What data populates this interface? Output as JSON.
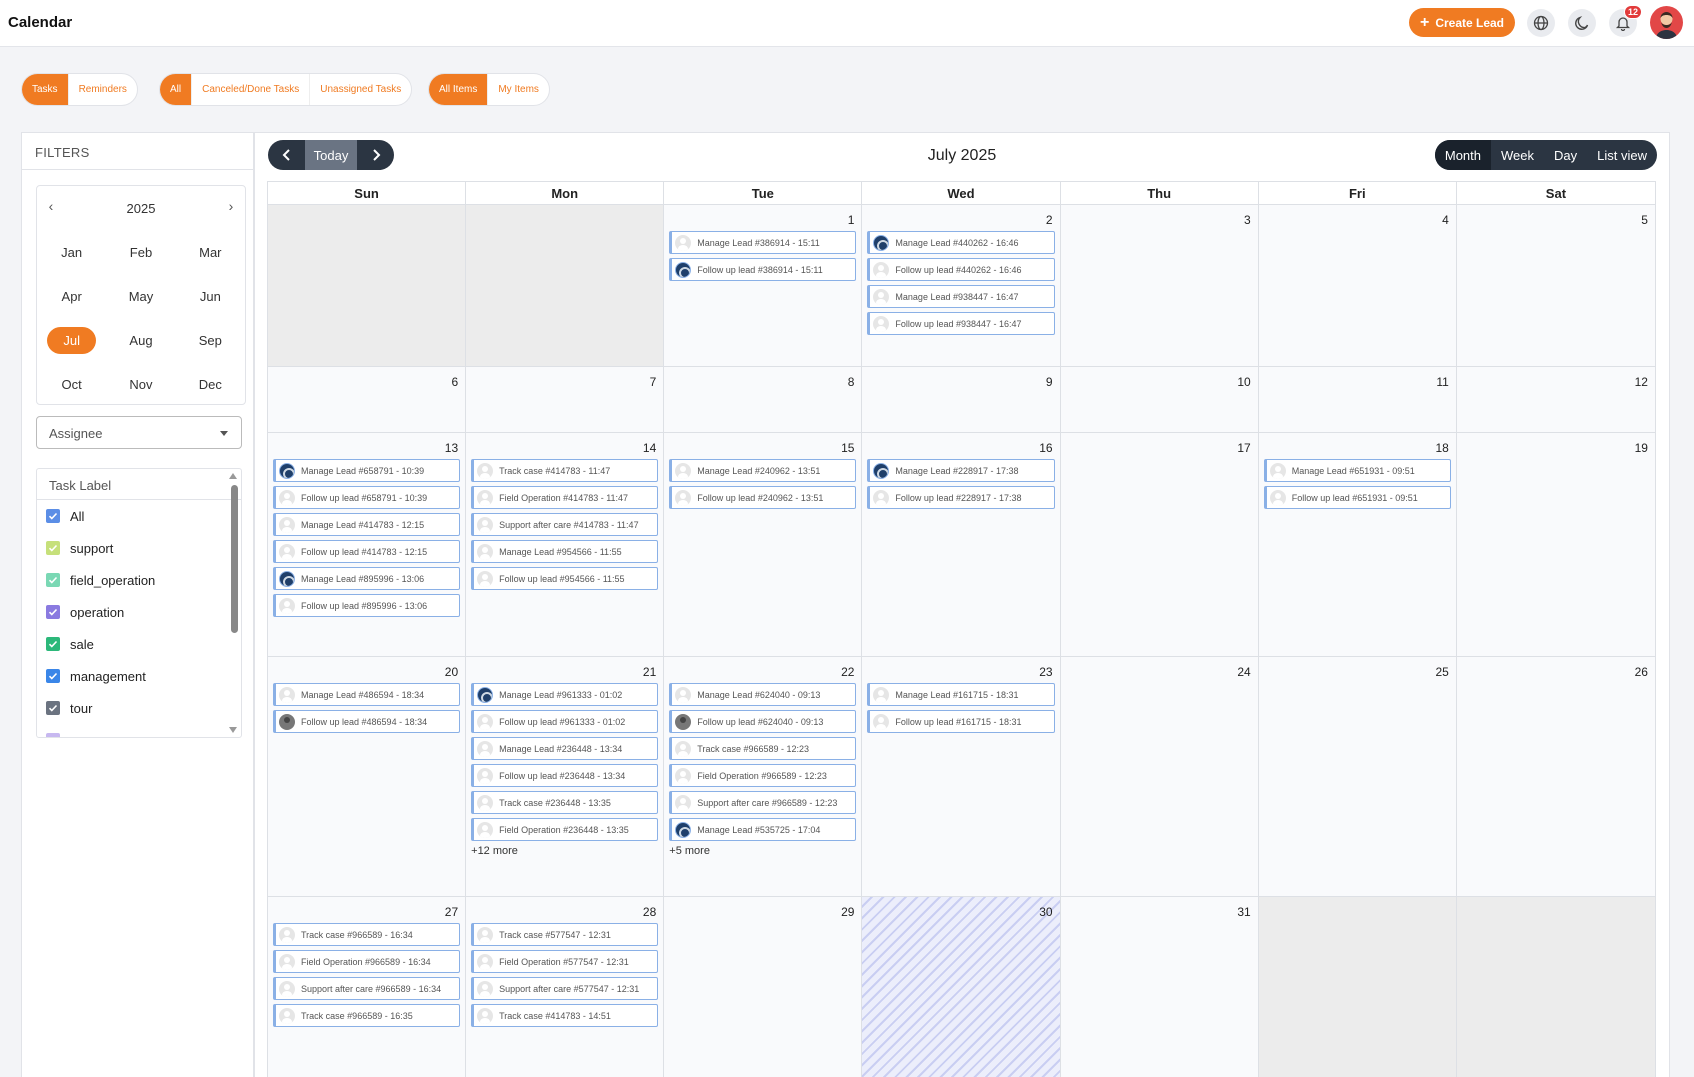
{
  "header": {
    "title": "Calendar",
    "create_label": "Create Lead",
    "notification_count": "12"
  },
  "segments": {
    "type": [
      "Tasks",
      "Reminders"
    ],
    "status": [
      "All",
      "Canceled/Done Tasks",
      "Unassigned Tasks"
    ],
    "scope": [
      "All Items",
      "My Items"
    ]
  },
  "sidebar": {
    "filters_title": "FILTERS",
    "year": "2025",
    "months": [
      "Jan",
      "Feb",
      "Mar",
      "Apr",
      "May",
      "Jun",
      "Jul",
      "Aug",
      "Sep",
      "Oct",
      "Nov",
      "Dec"
    ],
    "selected_month": "Jul",
    "assignee_placeholder": "Assignee",
    "task_label_title": "Task Label",
    "labels": [
      {
        "name": "All",
        "color": "#5b8ee6"
      },
      {
        "name": "support",
        "color": "#c6e07a"
      },
      {
        "name": "field_operation",
        "color": "#7ad8b4"
      },
      {
        "name": "operation",
        "color": "#8a7ae0"
      },
      {
        "name": "sale",
        "color": "#2cb87a"
      },
      {
        "name": "management",
        "color": "#3a86e8"
      },
      {
        "name": "tour",
        "color": "#6b7380"
      },
      {
        "name": "",
        "color": "#c7b8f0"
      }
    ]
  },
  "calendar": {
    "title": "July 2025",
    "today_label": "Today",
    "views": [
      "Month",
      "Week",
      "Day",
      "List view"
    ],
    "active_view": "Month",
    "weekdays": [
      "Sun",
      "Mon",
      "Tue",
      "Wed",
      "Thu",
      "Fri",
      "Sat"
    ],
    "weeks": [
      [
        {
          "num": "",
          "outside": true,
          "events": []
        },
        {
          "num": "",
          "outside": true,
          "events": []
        },
        {
          "num": "1",
          "events": [
            {
              "label": "Manage Lead #386914 - 15:11",
              "avatar": "gen"
            },
            {
              "label": "Follow up lead #386914 - 15:11",
              "avatar": "photo"
            }
          ]
        },
        {
          "num": "2",
          "events": [
            {
              "label": "Manage Lead #440262 - 16:46",
              "avatar": "photo"
            },
            {
              "label": "Follow up lead #440262 - 16:46",
              "avatar": "gen"
            },
            {
              "label": "Manage Lead #938447 - 16:47",
              "avatar": "gen"
            },
            {
              "label": "Follow up lead #938447 - 16:47",
              "avatar": "gen"
            }
          ]
        },
        {
          "num": "3",
          "events": []
        },
        {
          "num": "4",
          "events": []
        },
        {
          "num": "5",
          "events": []
        }
      ],
      [
        {
          "num": "6",
          "events": []
        },
        {
          "num": "7",
          "events": []
        },
        {
          "num": "8",
          "events": []
        },
        {
          "num": "9",
          "events": []
        },
        {
          "num": "10",
          "events": []
        },
        {
          "num": "11",
          "events": []
        },
        {
          "num": "12",
          "events": []
        }
      ],
      [
        {
          "num": "13",
          "events": [
            {
              "label": "Manage Lead #658791 - 10:39",
              "avatar": "photo"
            },
            {
              "label": "Follow up lead #658791 - 10:39",
              "avatar": "gen"
            },
            {
              "label": "Manage Lead #414783 - 12:15",
              "avatar": "gen"
            },
            {
              "label": "Follow up lead #414783 - 12:15",
              "avatar": "gen"
            },
            {
              "label": "Manage Lead #895996 - 13:06",
              "avatar": "photo"
            },
            {
              "label": "Follow up lead #895996 - 13:06",
              "avatar": "gen"
            }
          ]
        },
        {
          "num": "14",
          "events": [
            {
              "label": "Track case #414783 - 11:47",
              "avatar": "gen"
            },
            {
              "label": "Field Operation #414783 - 11:47",
              "avatar": "gen"
            },
            {
              "label": "Support after care #414783 - 11:47",
              "avatar": "gen"
            },
            {
              "label": "Manage Lead #954566 - 11:55",
              "avatar": "gen"
            },
            {
              "label": "Follow up lead #954566 - 11:55",
              "avatar": "gen"
            }
          ]
        },
        {
          "num": "15",
          "events": [
            {
              "label": "Manage Lead #240962 - 13:51",
              "avatar": "gen"
            },
            {
              "label": "Follow up lead #240962 - 13:51",
              "avatar": "gen"
            }
          ]
        },
        {
          "num": "16",
          "events": [
            {
              "label": "Manage Lead #228917 - 17:38",
              "avatar": "photo"
            },
            {
              "label": "Follow up lead #228917 - 17:38",
              "avatar": "gen"
            }
          ]
        },
        {
          "num": "17",
          "events": []
        },
        {
          "num": "18",
          "events": [
            {
              "label": "Manage Lead #651931 - 09:51",
              "avatar": "gen"
            },
            {
              "label": "Follow up lead #651931 - 09:51",
              "avatar": "gen"
            }
          ]
        },
        {
          "num": "19",
          "events": []
        }
      ],
      [
        {
          "num": "20",
          "events": [
            {
              "label": "Manage Lead #486594 - 18:34",
              "avatar": "gen"
            },
            {
              "label": "Follow up lead #486594 - 18:34",
              "avatar": "person"
            }
          ]
        },
        {
          "num": "21",
          "more": "+12 more",
          "events": [
            {
              "label": "Manage Lead #961333 - 01:02",
              "avatar": "photo"
            },
            {
              "label": "Follow up lead #961333 - 01:02",
              "avatar": "gen"
            },
            {
              "label": "Manage Lead #236448 - 13:34",
              "avatar": "gen"
            },
            {
              "label": "Follow up lead #236448 - 13:34",
              "avatar": "gen"
            },
            {
              "label": "Track case #236448 - 13:35",
              "avatar": "gen"
            },
            {
              "label": "Field Operation #236448 - 13:35",
              "avatar": "gen"
            }
          ]
        },
        {
          "num": "22",
          "more": "+5 more",
          "events": [
            {
              "label": "Manage Lead #624040 - 09:13",
              "avatar": "gen"
            },
            {
              "label": "Follow up lead #624040 - 09:13",
              "avatar": "person"
            },
            {
              "label": "Track case #966589 - 12:23",
              "avatar": "gen"
            },
            {
              "label": "Field Operation #966589 - 12:23",
              "avatar": "gen"
            },
            {
              "label": "Support after care #966589 - 12:23",
              "avatar": "gen"
            },
            {
              "label": "Manage Lead #535725 - 17:04",
              "avatar": "photo"
            }
          ]
        },
        {
          "num": "23",
          "events": [
            {
              "label": "Manage Lead #161715 - 18:31",
              "avatar": "gen"
            },
            {
              "label": "Follow up lead #161715 - 18:31",
              "avatar": "gen"
            }
          ]
        },
        {
          "num": "24",
          "events": []
        },
        {
          "num": "25",
          "events": []
        },
        {
          "num": "26",
          "events": []
        }
      ],
      [
        {
          "num": "27",
          "events": [
            {
              "label": "Track case #966589 - 16:34",
              "avatar": "gen"
            },
            {
              "label": "Field Operation #966589 - 16:34",
              "avatar": "gen"
            },
            {
              "label": "Support after care #966589 - 16:34",
              "avatar": "gen"
            },
            {
              "label": "Track case #966589 - 16:35",
              "avatar": "gen"
            }
          ]
        },
        {
          "num": "28",
          "events": [
            {
              "label": "Track case #577547 - 12:31",
              "avatar": "gen"
            },
            {
              "label": "Field Operation #577547 - 12:31",
              "avatar": "gen"
            },
            {
              "label": "Support after care #577547 - 12:31",
              "avatar": "gen"
            },
            {
              "label": "Track case #414783 - 14:51",
              "avatar": "gen"
            }
          ]
        },
        {
          "num": "29",
          "events": []
        },
        {
          "num": "30",
          "today": true,
          "events": []
        },
        {
          "num": "31",
          "events": []
        },
        {
          "num": "",
          "outside": true,
          "events": []
        },
        {
          "num": "",
          "outside": true,
          "events": []
        }
      ]
    ]
  }
}
